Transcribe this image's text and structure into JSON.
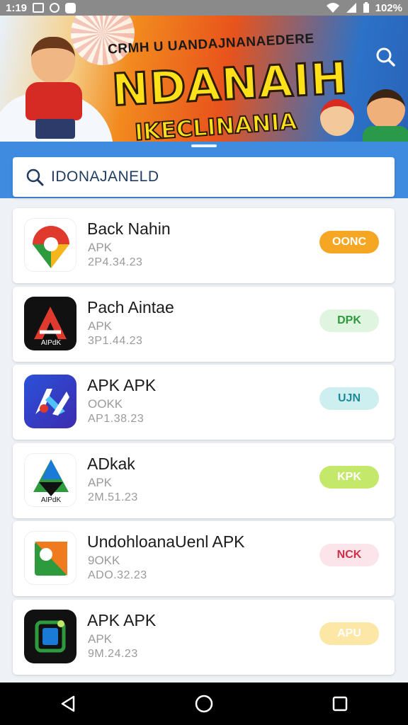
{
  "status_bar": {
    "time": "1:19",
    "battery_text": "102%"
  },
  "banner": {
    "subtitle": "CRMH U UANDAJNANAEDERE",
    "title": "NDANAIH",
    "tagline": "IKECLINANIA",
    "search_icon": "search-icon"
  },
  "search": {
    "value": "IDONAJANELD",
    "icon": "search-icon"
  },
  "apps": [
    {
      "name": "Back Nahin",
      "type": "APK",
      "size": "2P4.34.23",
      "button": "OONC",
      "button_bg": "#f5a623",
      "button_fg": "#ffffff"
    },
    {
      "name": "Pach Aintae",
      "type": "APK",
      "size": "3P1.44.23",
      "button": "DPK",
      "button_bg": "#dff5df",
      "button_fg": "#2e9a3e"
    },
    {
      "name": "APK APK",
      "type": "OOKK",
      "size": "AP1.38.23",
      "button": "UJN",
      "button_bg": "#cdeff0",
      "button_fg": "#1d8a9a"
    },
    {
      "name": "ADkak",
      "type": "APK",
      "size": "2M.51.23",
      "button": "KPK",
      "button_bg": "#c4e86a",
      "button_fg": "#ffffff"
    },
    {
      "name": "UndohloanaUenl APK",
      "type": "9OKK",
      "size": "ADO.32.23",
      "button": "NCK",
      "button_bg": "#fbe4ea",
      "button_fg": "#d0304a"
    },
    {
      "name": "APK APK",
      "type": "APK",
      "size": "9M.24.23",
      "button": "APU",
      "button_bg": "#fde7a6",
      "button_fg": "#ffffff"
    }
  ],
  "nav": {
    "back": "back-icon",
    "home": "home-icon",
    "recents": "recents-icon"
  },
  "colors": {
    "accent_blue": "#3f8be0",
    "background": "#eef1f5",
    "navbar": "#000000"
  }
}
